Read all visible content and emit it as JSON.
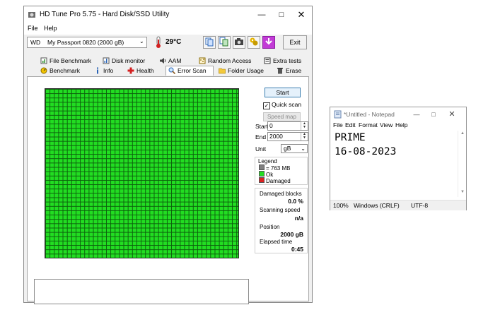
{
  "hdtune": {
    "title": "HD Tune Pro 5.75 - Hard Disk/SSD Utility",
    "menu": [
      "File",
      "Help"
    ],
    "drive": {
      "prefix": "WD",
      "name": "My Passport 0820 (2000 gB)"
    },
    "temperature": "29°C",
    "exit_label": "Exit",
    "tabs_top": [
      "File Benchmark",
      "Disk monitor",
      "AAM",
      "Random Access",
      "Extra tests"
    ],
    "tabs_bottom": [
      "Benchmark",
      "Info",
      "Health",
      "Error Scan",
      "Folder Usage",
      "Erase"
    ],
    "active_tab": "Error Scan",
    "controls": {
      "start_label": "Start",
      "quick_scan_label": "Quick scan",
      "quick_scan_checked": true,
      "speed_map_label": "Speed map",
      "start_field_label": "Start",
      "start_value": "0",
      "end_field_label": "End",
      "end_value": "2000",
      "unit_label": "Unit",
      "unit_value": "gB"
    },
    "legend": {
      "title": "Legend",
      "items": [
        {
          "label": "= 763 MB",
          "color": "#7f7f7f"
        },
        {
          "label": "Ok",
          "color": "#22dd22"
        },
        {
          "label": "Damaged",
          "color": "#dd2222"
        }
      ]
    },
    "stats": {
      "damaged_label": "Damaged blocks",
      "damaged_value": "0.0 %",
      "speed_label": "Scanning speed",
      "speed_value": "n/a",
      "position_label": "Position",
      "position_value": "2000 gB",
      "elapsed_label": "Elapsed time",
      "elapsed_value": "0:45"
    },
    "map_colors": {
      "ok": "#22dd22",
      "grid": "#0d5e0d"
    }
  },
  "notepad": {
    "title": "*Untitled - Notepad",
    "menu": [
      "File",
      "Edit",
      "Format",
      "View",
      "Help"
    ],
    "lines": [
      "PRIME",
      "16-08-2023"
    ],
    "status": {
      "zoom": "100%",
      "line_ending": "Windows (CRLF)",
      "encoding": "UTF-8"
    }
  }
}
